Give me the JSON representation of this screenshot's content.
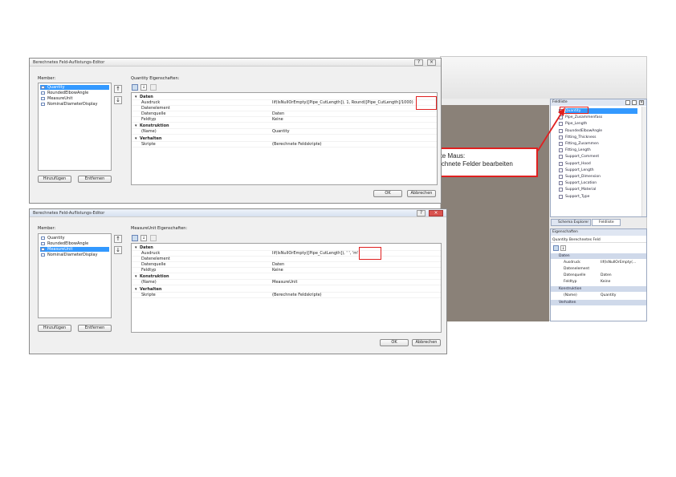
{
  "background_app": {
    "field_explorer": {
      "title": "Feldliste",
      "items": [
        "Quantity",
        "Pipe_Zusammenfass",
        "Pipe_Length",
        "RoundedElbowAngle",
        "Fitting_Thickness",
        "Fitting_Zusammen",
        "Fitting_Length",
        "Support_Comment",
        "Support_Hood",
        "Support_Length",
        "Support_Dimension",
        "Support_Location",
        "Support_Material",
        "Support_Type"
      ],
      "selected_index": 0
    },
    "tabs": [
      "Schema Explorer",
      "Feldliste"
    ],
    "properties": {
      "title": "Eigenschaften",
      "object": "Quantity  Berechnetes Feld",
      "cat_daten": "Daten",
      "rows_daten": [
        {
          "name": "Ausdruck",
          "value": "Iif(IsNullOrEmpty(..."
        },
        {
          "name": "Datenelement",
          "value": ""
        },
        {
          "name": "Datenquelle",
          "value": "Daten"
        },
        {
          "name": "Feldtyp",
          "value": "Keine"
        }
      ],
      "cat_konstruktion": "Konstruktion",
      "rows_konstruktion": [
        {
          "name": "(Name)",
          "value": "Quantity"
        }
      ],
      "cat_verhalten": "Verhalten"
    }
  },
  "callout": {
    "line1": "rechte Maus:",
    "line2": "Berechnete Felder bearbeiten"
  },
  "dialog1": {
    "title": "Berechnetes Feld-Auflistungs-Editor",
    "members_label": "Member:",
    "members": [
      {
        "label": "Quantity",
        "selected": true
      },
      {
        "label": "RoundedElbowAngle",
        "selected": false
      },
      {
        "label": "MeasureUnit",
        "selected": false
      },
      {
        "label": "NominalDiameterDisplay",
        "selected": false
      }
    ],
    "props_label": "Quantity Eigenschaften:",
    "cat_daten": "Daten",
    "rows_daten": [
      {
        "name": "Ausdruck",
        "value": "Iif(IsNullOrEmpty([Pipe_CutLength]),  1, Round([Pipe_CutLength]/1000)"
      },
      {
        "name": "Datenelement",
        "value": ""
      },
      {
        "name": "Datenquelle",
        "value": "Daten"
      },
      {
        "name": "Feldtyp",
        "value": "Keine"
      }
    ],
    "cat_konstruktion": "Konstruktion",
    "rows_konstruktion": [
      {
        "name": "(Name)",
        "value": "Quantity"
      }
    ],
    "cat_verhalten": "Verhalten",
    "rows_verhalten": [
      {
        "name": "Skripte",
        "value": "(Berechnete Feldskripte)"
      }
    ],
    "add_label": "Hinzufügen",
    "remove_label": "Entfernen",
    "ok_label": "OK",
    "cancel_label": "Abbrechen"
  },
  "dialog2": {
    "title": "Berechnetes Feld-Auflistungs-Editor",
    "members_label": "Member:",
    "members": [
      {
        "label": "Quantity",
        "selected": false
      },
      {
        "label": "RoundedElbowAngle",
        "selected": false
      },
      {
        "label": "MeasureUnit",
        "selected": true
      },
      {
        "label": "NominalDiameterDisplay",
        "selected": false
      }
    ],
    "props_label": "MeasureUnit Eigenschaften:",
    "cat_daten": "Daten",
    "rows_daten": [
      {
        "name": "Ausdruck",
        "value": "Iif(IsNullOrEmpty([Pipe_CutLength]), ' ', 'm')"
      },
      {
        "name": "Datenelement",
        "value": ""
      },
      {
        "name": "Datenquelle",
        "value": "Daten"
      },
      {
        "name": "Feldtyp",
        "value": "Keine"
      }
    ],
    "cat_konstruktion": "Konstruktion",
    "rows_konstruktion": [
      {
        "name": "(Name)",
        "value": "MeasureUnit"
      }
    ],
    "cat_verhalten": "Verhalten",
    "rows_verhalten": [
      {
        "name": "Skripte",
        "value": "(Berechnete Feldskripte)"
      }
    ],
    "add_label": "Hinzufügen",
    "remove_label": "Entfernen",
    "ok_label": "OK",
    "cancel_label": "Abbrechen"
  },
  "colors": {
    "highlight": "#e02020",
    "selection": "#3399ff",
    "background_gray": "#8a8178"
  }
}
